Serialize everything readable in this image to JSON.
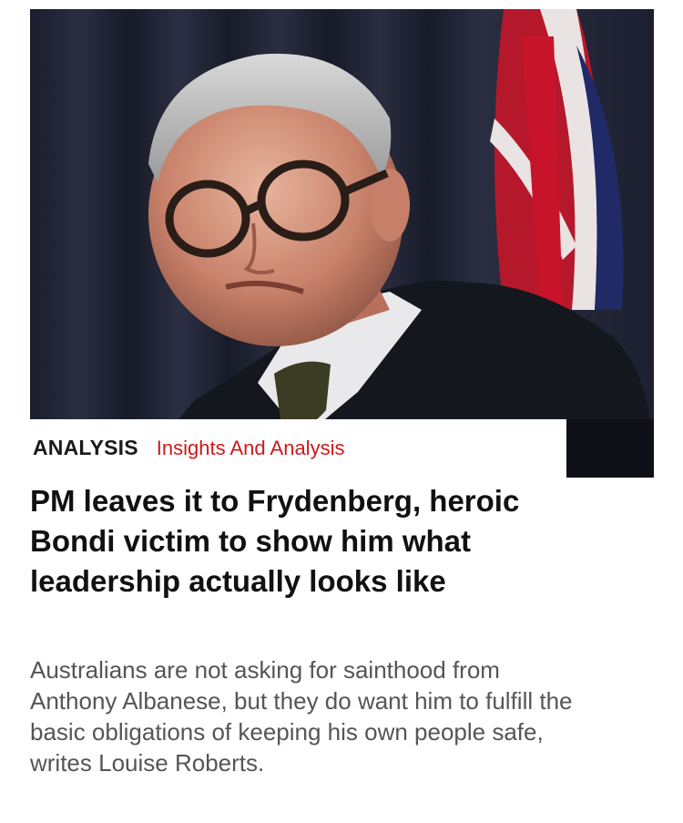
{
  "article": {
    "image": {
      "description_icon": "photo-icon"
    },
    "kicker": "ANALYSIS",
    "section": "Insights And Analysis",
    "headline": "PM leaves it to Frydenberg, heroic Bondi victim to show him what leadership actually looks like",
    "dek": "Australians are not asking for sainthood from Anthony Albanese, but they do want him to fulfill the basic obligations of keeping his own people safe, writes Louise Roberts."
  },
  "colors": {
    "section_red": "#cc1a1a",
    "headline": "#111111",
    "dek": "#555555"
  }
}
